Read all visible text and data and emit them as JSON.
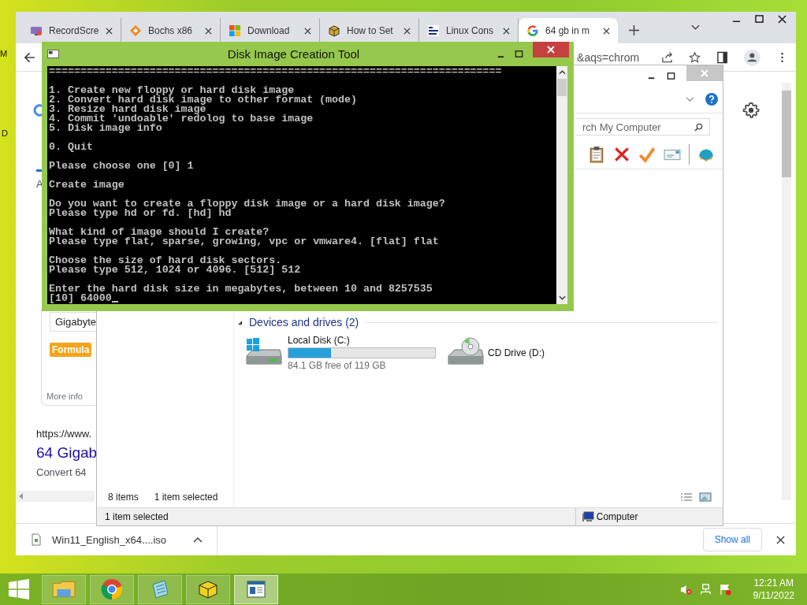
{
  "desktop": {
    "icon_labels": [
      "M",
      "D"
    ]
  },
  "browser": {
    "tabs": [
      {
        "kind": "recorder",
        "title": "RecordScre",
        "selected": false
      },
      {
        "kind": "bochs",
        "title": "Bochs x86",
        "selected": false
      },
      {
        "kind": "windows",
        "title": "Download",
        "selected": false
      },
      {
        "kind": "box",
        "title": "How to Set",
        "selected": false
      },
      {
        "kind": "starman",
        "title": "Linux Cons",
        "selected": false
      },
      {
        "kind": "google",
        "title": "64 gb in m",
        "selected": true
      }
    ],
    "address": "&aqs=chrom",
    "page": {
      "tab_letter": "A",
      "chip": "Gigabyte",
      "badge": "Formula",
      "more": "More info",
      "url": "https://www.",
      "title": "64 Gigab",
      "snippet": "Convert 64"
    },
    "download": {
      "file": "Win11_English_x64....iso",
      "show_all": "Show all"
    }
  },
  "explorer": {
    "search_placeholder": "rch My Computer",
    "group": "Devices and drives (2)",
    "drives": [
      {
        "kind": "disk",
        "name": "Local Disk (C:)",
        "level": 0.29,
        "free": "84.1 GB free of 119 GB"
      },
      {
        "kind": "cd",
        "name": "CD Drive (D:)"
      }
    ],
    "item_count": "8 items",
    "selection": "1 item selected",
    "status": "1 item selected",
    "location": "Computer"
  },
  "console": {
    "title": "Disk Image Creation Tool",
    "paragraphs": [
      [
        "========================================================================"
      ],
      [
        "1. Create new floppy or hard disk image",
        "2. Convert hard disk image to other format (mode)",
        "3. Resize hard disk image",
        "4. Commit 'undoable' redolog to base image",
        "5. Disk image info"
      ],
      [
        "0. Quit"
      ],
      [
        "Please choose one [0] 1"
      ],
      [
        "Create image"
      ],
      [
        "Do you want to create a floppy disk image or a hard disk image?",
        "Please type hd or fd. [hd] hd"
      ],
      [
        "What kind of image should I create?",
        "Please type flat, sparse, growing, vpc or vmware4. [flat] flat"
      ],
      [
        "Choose the size of hard disk sectors.",
        "Please type 512, 1024 or 4096. [512] 512"
      ],
      [
        "Enter the hard disk size in megabytes, between 10 and 8257535",
        "[10] 64000"
      ]
    ]
  },
  "taskbar": {
    "apps": [
      {
        "kind": "folder",
        "selected": false
      },
      {
        "kind": "chrome",
        "selected": false
      },
      {
        "kind": "notepad",
        "selected": false
      },
      {
        "kind": "box",
        "selected": false
      },
      {
        "kind": "window",
        "selected": true
      }
    ],
    "time": "12:21 AM",
    "date": "9/11/2022"
  }
}
